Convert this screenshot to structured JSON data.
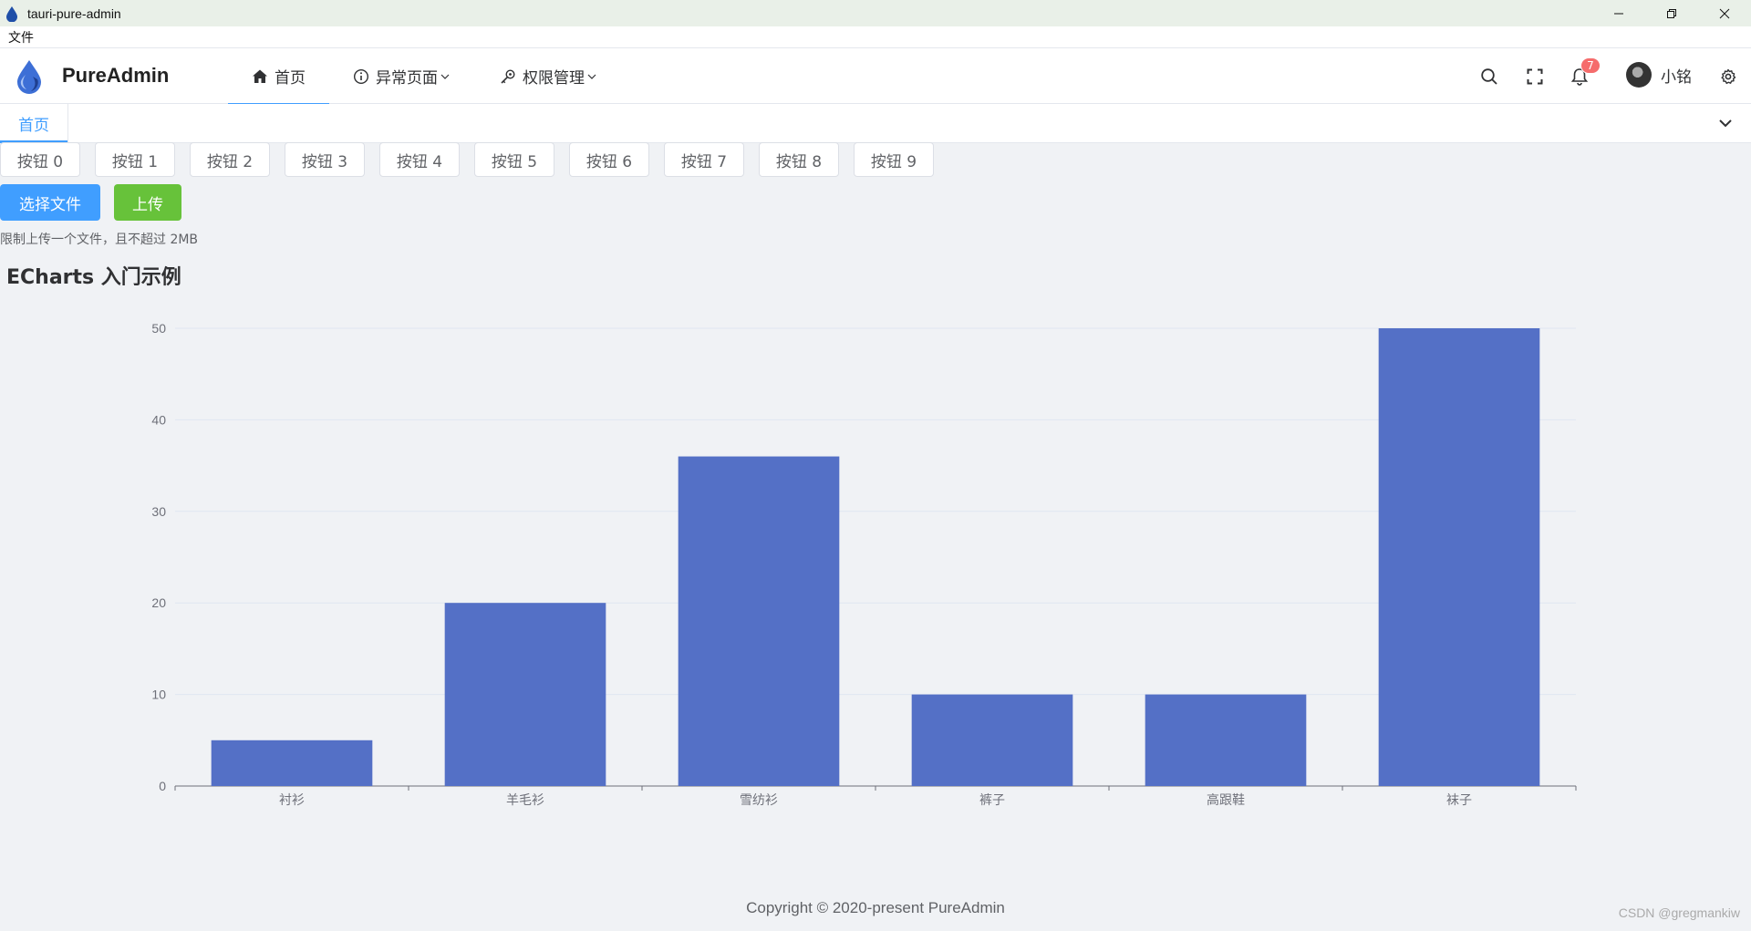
{
  "window": {
    "title": "tauri-pure-admin",
    "controls": [
      "minimize-icon",
      "restore-icon",
      "close-icon"
    ]
  },
  "menubar": {
    "file": "文件"
  },
  "header": {
    "brand": "PureAdmin",
    "nav": [
      {
        "label": "首页",
        "icon": "home-icon",
        "active": true
      },
      {
        "label": "异常页面",
        "icon": "info-circle-icon",
        "dropdown": true
      },
      {
        "label": "权限管理",
        "icon": "key-icon",
        "dropdown": true
      }
    ],
    "notification_count": "7",
    "username": "小铭"
  },
  "tags": {
    "active_tag": "首页"
  },
  "buttons": [
    "按钮 0",
    "按钮 1",
    "按钮 2",
    "按钮 3",
    "按钮 4",
    "按钮 5",
    "按钮 6",
    "按钮 7",
    "按钮 8",
    "按钮 9"
  ],
  "upload": {
    "select_label": "选择文件",
    "upload_label": "上传",
    "tip": "限制上传一个文件，且不超过 2MB"
  },
  "chart_title": "ECharts 入门示例",
  "chart_data": {
    "type": "bar",
    "title": "ECharts 入门示例",
    "categories": [
      "衬衫",
      "羊毛衫",
      "雪纺衫",
      "裤子",
      "高跟鞋",
      "袜子"
    ],
    "series": [
      {
        "values": [
          5,
          20,
          36,
          10,
          10,
          50
        ]
      }
    ],
    "ylim": [
      0,
      50
    ],
    "yticks": [
      0,
      10,
      20,
      30,
      40,
      50
    ],
    "grid": true,
    "bar_color": "#5470c6"
  },
  "footer": "Copyright © 2020-present PureAdmin",
  "watermark": "CSDN @gregmankiw",
  "colors": {
    "primary": "#409eff",
    "success": "#67c23a",
    "danger": "#f56c6c"
  }
}
